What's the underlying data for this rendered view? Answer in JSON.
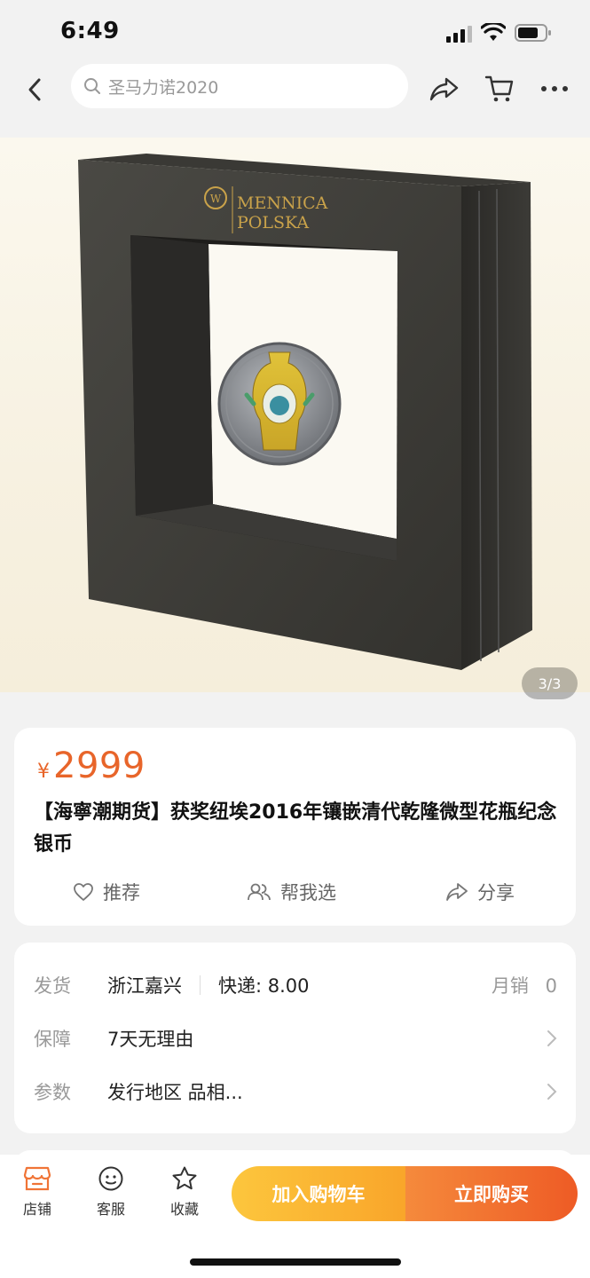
{
  "status_bar": {
    "time": "6:49"
  },
  "nav": {
    "search_placeholder": "圣马力诺2020",
    "icons": [
      "back-icon",
      "search-icon",
      "share-icon",
      "cart-icon",
      "more-icon"
    ]
  },
  "hero": {
    "brand_line1": "MENNICA",
    "brand_line2": "POLSKA",
    "image_counter": "3/3"
  },
  "product": {
    "currency": "¥",
    "price": "2999",
    "title": "【海寧潮期货】获奖纽埃2016年镶嵌清代乾隆微型花瓶纪念银币",
    "actions": [
      {
        "icon": "heart-icon",
        "label": "推荐"
      },
      {
        "icon": "users-icon",
        "label": "帮我选"
      },
      {
        "icon": "share-icon",
        "label": "分享"
      }
    ]
  },
  "info": {
    "shipping": {
      "label": "发货",
      "origin": "浙江嘉兴",
      "express": "快递: 8.00",
      "monthly_sales_label": "月销",
      "monthly_sales": "0"
    },
    "guarantee": {
      "label": "保障",
      "value": "7天无理由"
    },
    "params": {
      "label": "参数",
      "value": "发行地区 品相..."
    }
  },
  "bottom_bar": {
    "tabs": [
      {
        "icon": "store-icon",
        "label": "店铺"
      },
      {
        "icon": "customer-service-icon",
        "label": "客服"
      },
      {
        "icon": "star-icon",
        "label": "收藏"
      }
    ],
    "add_to_cart": "加入购物车",
    "buy_now": "立即购买"
  },
  "colors": {
    "accent": "#e8652a",
    "cart_button": "#fbb733",
    "buy_button": "#f06a2c",
    "store_icon": "#f07436"
  }
}
